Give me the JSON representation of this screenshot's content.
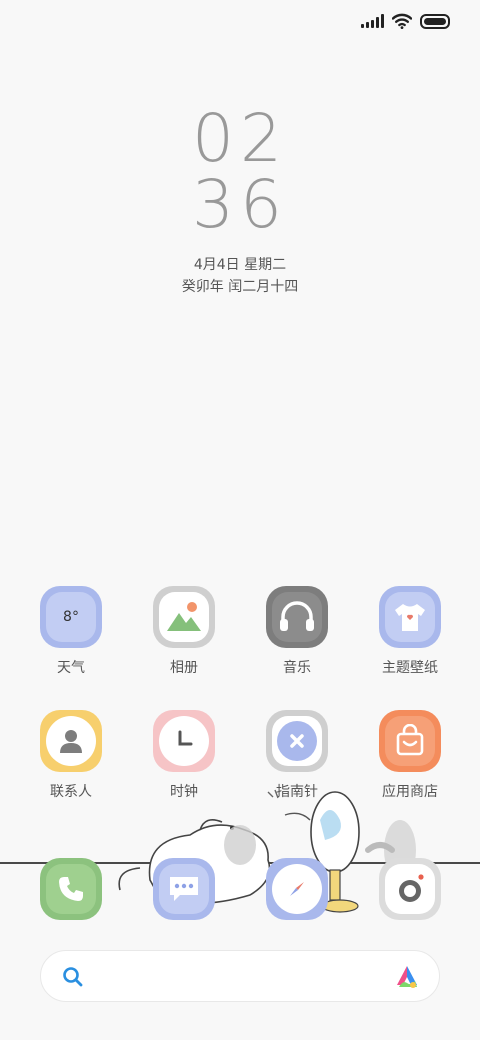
{
  "clock": {
    "hour": "02",
    "minute": "36"
  },
  "date": {
    "line1": "4月4日 星期二",
    "line2": "癸卯年 闰二月十四"
  },
  "apps_row1": [
    {
      "label": "天气",
      "icon": "weather-icon",
      "badge": "8°",
      "color": "#a9b8ec"
    },
    {
      "label": "相册",
      "icon": "gallery-icon",
      "color": "#cfcfcf"
    },
    {
      "label": "音乐",
      "icon": "music-headphones-icon",
      "color": "#7d7d7d"
    },
    {
      "label": "主题壁纸",
      "icon": "theme-tshirt-icon",
      "color": "#a9b8ec"
    }
  ],
  "apps_row2": [
    {
      "label": "联系人",
      "icon": "contacts-icon",
      "color": "#f7cf6d"
    },
    {
      "label": "时钟",
      "icon": "clock-icon",
      "color": "#f6c4c6"
    },
    {
      "label": "指南针",
      "icon": "compass-icon",
      "color": "#cfcfcf"
    },
    {
      "label": "应用商店",
      "icon": "app-store-bag-icon",
      "color": "#f48c5c"
    }
  ],
  "dock": [
    {
      "name": "phone",
      "icon": "phone-icon",
      "color": "#8cc27e"
    },
    {
      "name": "messages",
      "icon": "messages-icon",
      "color": "#a9b8ec"
    },
    {
      "name": "browser",
      "icon": "browser-compass-icon",
      "color": "#a9b8ec"
    },
    {
      "name": "camera",
      "icon": "camera-icon",
      "color": "#dcdcdc"
    }
  ],
  "search": {
    "icon": "search-icon",
    "logo": "assistant-logo-icon"
  }
}
